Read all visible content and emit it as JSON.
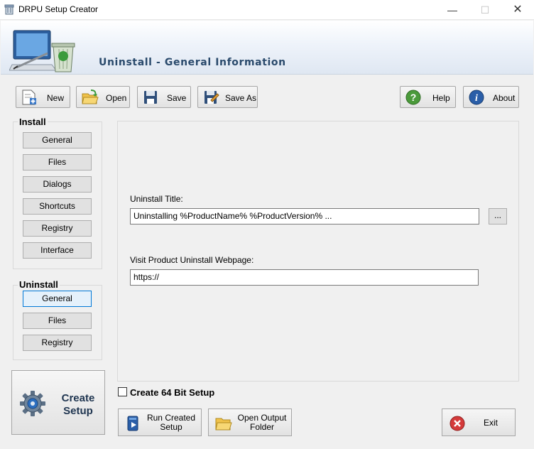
{
  "window": {
    "title": "DRPU Setup Creator",
    "minimize": "—",
    "maximize": "☐",
    "close": "✕"
  },
  "banner": {
    "title": "Uninstall - General Information"
  },
  "toolbar": {
    "new": "New",
    "open": "Open",
    "save": "Save",
    "save_as": "Save As",
    "help": "Help",
    "about": "About"
  },
  "install": {
    "title": "Install",
    "items": [
      "General",
      "Files",
      "Dialogs",
      "Shortcuts",
      "Registry",
      "Interface"
    ]
  },
  "uninstall": {
    "title": "Uninstall",
    "items": [
      "General",
      "Files",
      "Registry"
    ],
    "active_index": 0
  },
  "form": {
    "uninstall_title_label": "Uninstall Title:",
    "uninstall_title_value": "Uninstalling %ProductName% %ProductVersion% ...",
    "browse_label": "...",
    "webpage_label": "Visit Product Uninstall Webpage:",
    "webpage_value": "https://"
  },
  "options": {
    "create_64bit": "Create 64 Bit Setup",
    "create_64bit_checked": false
  },
  "actions": {
    "create_setup_line1": "Create",
    "create_setup_line2": "Setup",
    "run_setup_line1": "Run Created",
    "run_setup_line2": "Setup",
    "open_folder_line1": "Open Output",
    "open_folder_line2": "Folder",
    "exit": "Exit"
  },
  "colors": {
    "accent": "#0078d7",
    "banner_title": "#2a4a6c",
    "help_green": "#4a9a3a",
    "about_blue": "#2a5ea8",
    "exit_red": "#d43a3a"
  }
}
